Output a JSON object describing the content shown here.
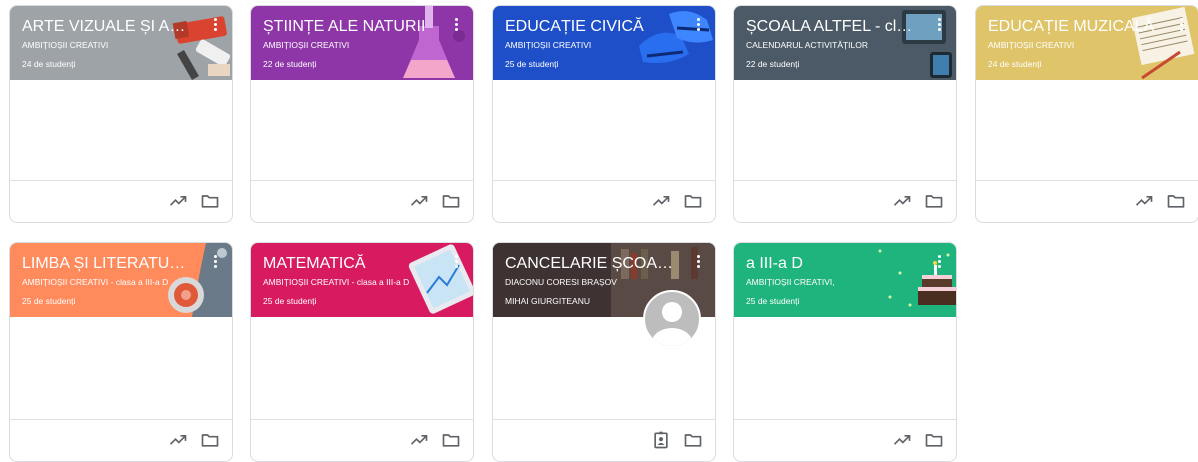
{
  "cards": [
    {
      "title": "ARTE VIZUALE ȘI ABIL...",
      "subtitle": "AMBIȚIOȘII CREATIVI",
      "students": "24 de studenți",
      "color": "#9ea3a8",
      "art": "paint-tubes",
      "footer": [
        "trending-up-icon",
        "folder-icon"
      ]
    },
    {
      "title": "ȘTIINȚE ALE NATURII",
      "subtitle": "AMBIȚIOȘII CREATIVI",
      "students": "22 de studenți",
      "color": "#8e35a8",
      "art": "lab-flask",
      "footer": [
        "trending-up-icon",
        "folder-icon"
      ]
    },
    {
      "title": "EDUCAȚIE CIVICĂ",
      "subtitle": "AMBIȚIOȘII CREATIVI",
      "students": "25 de studenți",
      "color": "#1e4fc8",
      "art": "sneakers",
      "footer": [
        "trending-up-icon",
        "folder-icon"
      ]
    },
    {
      "title": "ȘCOALA ALTFEL - cla...",
      "subtitle": "CALENDARUL ACTIVITĂȚILOR",
      "students": "22 de studenți",
      "color": "#4b5a66",
      "art": "tablets",
      "footer": [
        "trending-up-icon",
        "folder-icon"
      ]
    },
    {
      "title": "EDUCAȚIE MUZICALĂ",
      "subtitle": "AMBIȚIOȘII CREATIVI",
      "students": "24 de studenți",
      "color": "#dfc46a",
      "art": "sheet-music",
      "footer": [
        "trending-up-icon",
        "folder-icon"
      ]
    },
    {
      "title": "LIMBA ȘI LITERATURA...",
      "subtitle": "AMBIȚIOȘII CREATIVI - clasa a III-a D",
      "students": "25 de studenți",
      "color": "#ff8a5c",
      "art": "teacup",
      "footer": [
        "trending-up-icon",
        "folder-icon"
      ]
    },
    {
      "title": "MATEMATICĂ",
      "subtitle": "AMBIȚIOȘII CREATIVI - clasa a III-a D",
      "students": "25 de studenți",
      "color": "#d81b60",
      "art": "tablet-graph",
      "footer": [
        "trending-up-icon",
        "folder-icon"
      ]
    },
    {
      "title": "CANCELARIE ȘCOAL...",
      "subtitle": "DIACONU CORESI BRAȘOV",
      "teacher": "MIHAI GIURGITEANU",
      "color": "#4a3d3d",
      "art": "bookshelf",
      "avatar": true,
      "footer": [
        "assignment-ind-icon",
        "folder-icon"
      ]
    },
    {
      "title": "a III-a D",
      "subtitle": "AMBIȚIOȘII CREATIVI,",
      "students": "25 de studenți",
      "color": "#1fb47d",
      "art": "birthday-cake",
      "footer": [
        "trending-up-icon",
        "folder-icon"
      ]
    }
  ]
}
